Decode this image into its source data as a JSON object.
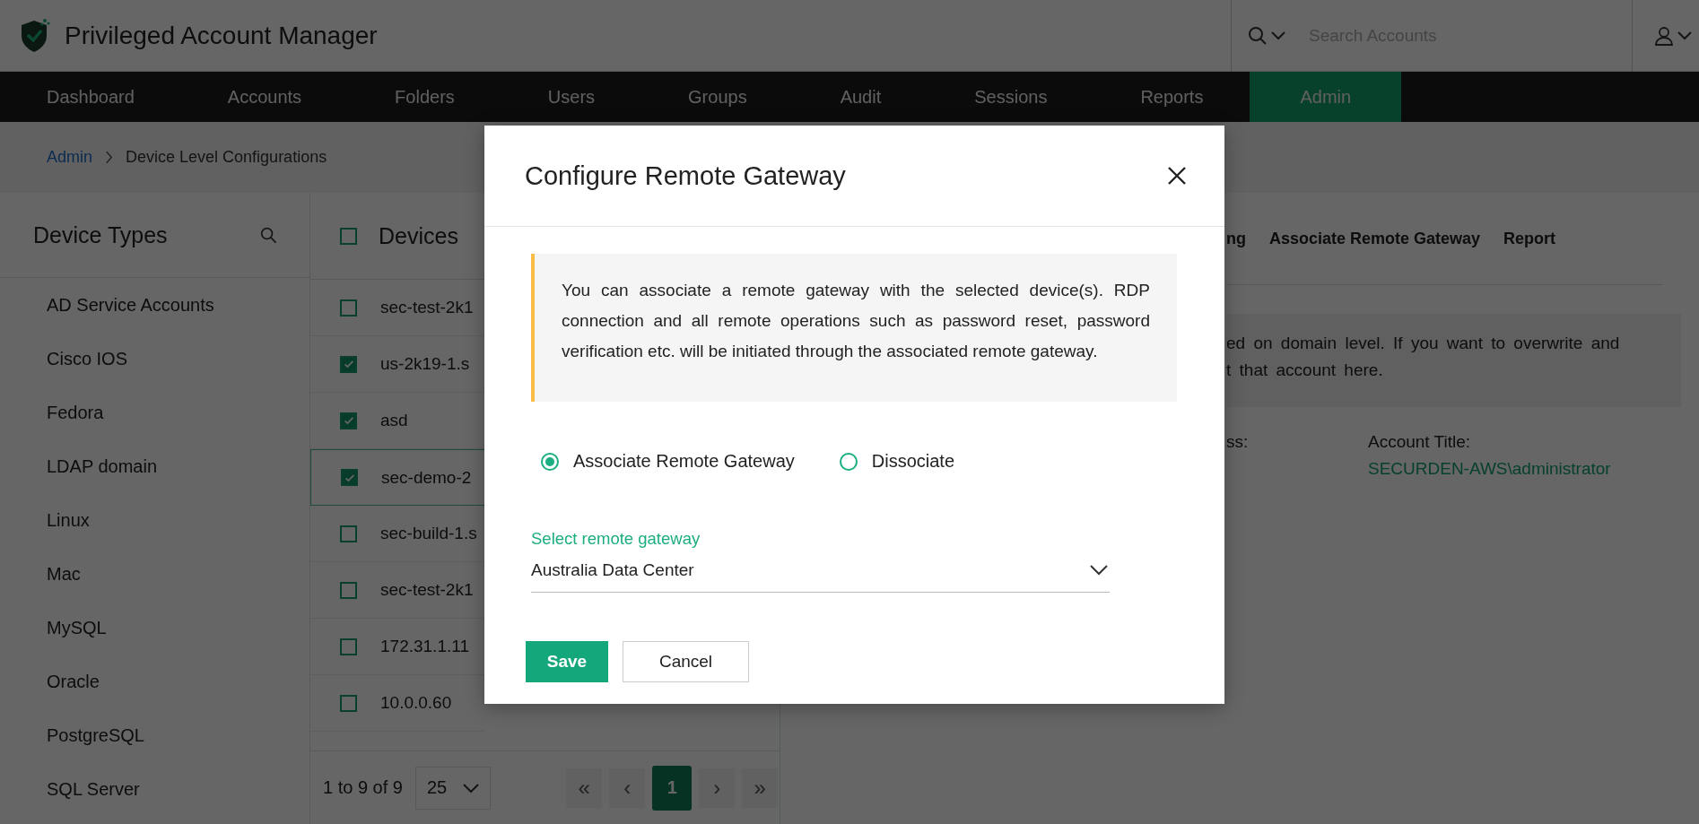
{
  "header": {
    "app_title": "Privileged Account Manager",
    "search": {
      "placeholder": "Search Accounts"
    }
  },
  "nav": [
    {
      "label": "Dashboard",
      "selected": false
    },
    {
      "label": "Accounts",
      "selected": false
    },
    {
      "label": "Folders",
      "selected": false
    },
    {
      "label": "Users",
      "selected": false
    },
    {
      "label": "Groups",
      "selected": false
    },
    {
      "label": "Audit",
      "selected": false
    },
    {
      "label": "Sessions",
      "selected": false
    },
    {
      "label": "Reports",
      "selected": false
    },
    {
      "label": "Admin",
      "selected": true
    }
  ],
  "breadcrumb": [
    {
      "label": "Admin",
      "kind": "link"
    },
    {
      "label": "Device Level Configurations",
      "kind": "current"
    }
  ],
  "device_types": {
    "title": "Device Types",
    "items": [
      "AD Service Accounts",
      "Cisco IOS",
      "Fedora",
      "LDAP domain",
      "Linux",
      "Mac",
      "MySQL",
      "Oracle",
      "PostgreSQL",
      "SQL Server"
    ]
  },
  "devices": {
    "title": "Devices",
    "header_checked": false,
    "rows": [
      {
        "name": "sec-test-2k1",
        "checked": false,
        "selected": false
      },
      {
        "name": "us-2k19-1.s",
        "checked": true,
        "selected": false
      },
      {
        "name": "asd",
        "checked": true,
        "selected": false
      },
      {
        "name": "sec-demo-2",
        "checked": true,
        "selected": true
      },
      {
        "name": "sec-build-1.s",
        "checked": false,
        "selected": false
      },
      {
        "name": "sec-test-2k1",
        "checked": false,
        "selected": false
      },
      {
        "name": "172.31.1.11",
        "checked": false,
        "selected": false
      },
      {
        "name": "10.0.0.60",
        "checked": false,
        "selected": false
      }
    ],
    "pagination": {
      "summary": "1 to 9 of 9",
      "page_size": "25",
      "pages": [
        {
          "label": "«",
          "kind": "nav",
          "disabled": true,
          "selected": false
        },
        {
          "label": "‹",
          "kind": "nav",
          "disabled": true,
          "selected": false
        },
        {
          "label": "1",
          "kind": "page",
          "disabled": false,
          "selected": true
        },
        {
          "label": "›",
          "kind": "nav",
          "disabled": true,
          "selected": false
        },
        {
          "label": "»",
          "kind": "nav",
          "disabled": true,
          "selected": false
        }
      ]
    }
  },
  "right_panel": {
    "tabs": [
      "ng",
      "Associate Remote Gateway",
      "Report"
    ],
    "notice_lines": [
      "ed on domain level. If you want to overwrite and",
      "t that account here."
    ],
    "fields": [
      {
        "label": "ss:"
      },
      {
        "label": "Account Title:",
        "value": "SECURDEN-AWS\\administrator"
      }
    ]
  },
  "dialog": {
    "title": "Configure Remote Gateway",
    "notice": "You can associate a remote gateway with the selected device(s). RDP connection and all remote operations such as password reset, password verification etc. will be initiated through the associated remote gateway.",
    "options": [
      {
        "label": "Associate Remote Gateway",
        "selected": true
      },
      {
        "label": "Dissociate",
        "selected": false
      }
    ],
    "select": {
      "label": "Select remote gateway",
      "value": "Australia Data Center"
    },
    "buttons": [
      {
        "label": "Save",
        "kind": "primary"
      },
      {
        "label": "Cancel",
        "kind": "secondary"
      }
    ]
  }
}
